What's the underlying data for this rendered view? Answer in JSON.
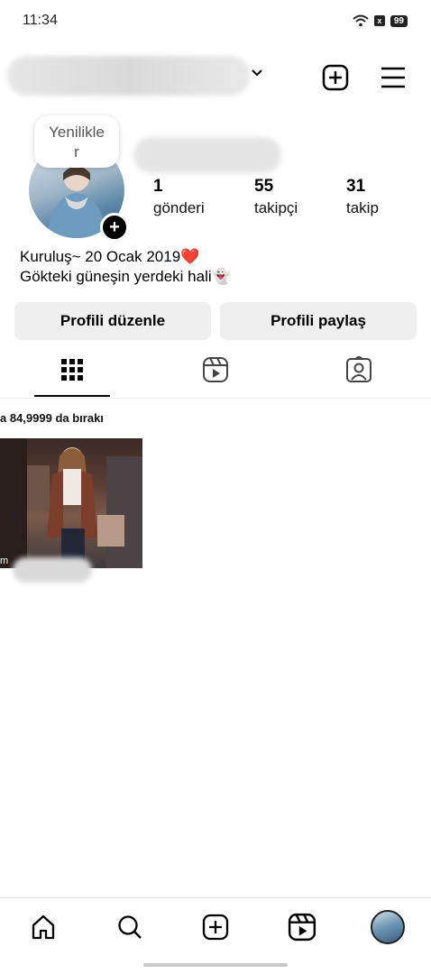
{
  "status_bar": {
    "time": "11:34",
    "battery": "99"
  },
  "profile": {
    "story_label": "Yenilikle\nr",
    "stats": [
      {
        "value": "1",
        "label": "gönderi"
      },
      {
        "value": "55",
        "label": "takipçi"
      },
      {
        "value": "31",
        "label": "takip"
      }
    ],
    "bio_line1": "Kuruluş~ 20 Ocak 2019❤️",
    "bio_line2": "Gökteki güneşin yerdeki hali👻"
  },
  "buttons": {
    "edit": "Profili düzenle",
    "share": "Profili paylaş"
  },
  "tabs": [
    "grid-icon",
    "reels-icon",
    "tagged-icon"
  ],
  "post": {
    "note": "a 84,9999 da bırakı",
    "caption": "m"
  },
  "nav": [
    "home-icon",
    "search-icon",
    "create-icon",
    "reels-icon",
    "profile-avatar"
  ]
}
